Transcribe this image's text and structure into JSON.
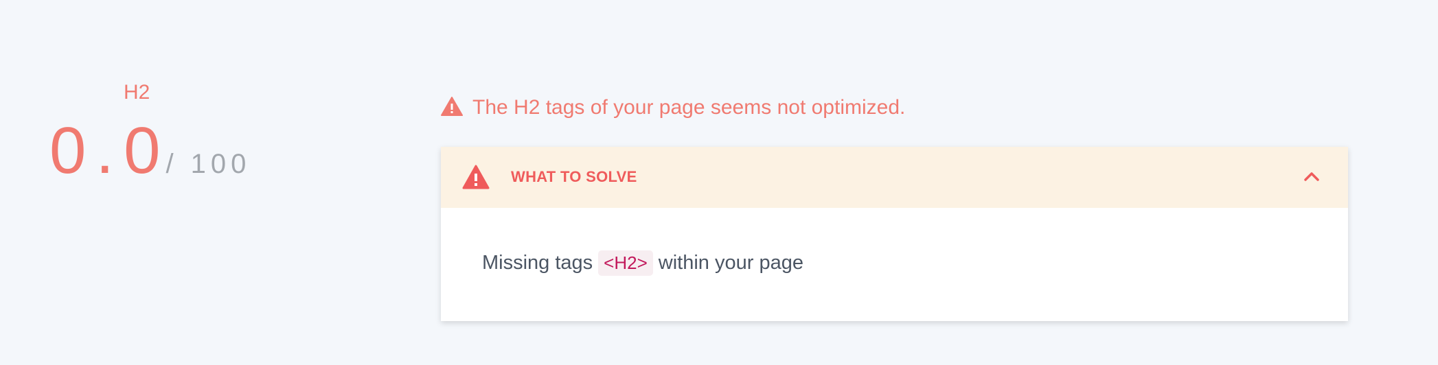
{
  "score": {
    "label": "H2",
    "value": "0.0",
    "max": "/ 100"
  },
  "warning": {
    "icon": "warning-triangle-icon",
    "text": "The H2 tags of your page seems not optimized."
  },
  "card": {
    "header_icon": "warning-triangle-icon",
    "title": "WHAT TO SOLVE",
    "toggle_icon": "chevron-up-icon",
    "issue": {
      "prefix": "Missing tags",
      "tag": "<H2>",
      "suffix": "within your page"
    }
  },
  "colors": {
    "background": "#f4f7fb",
    "accent": "#f07a70",
    "danger": "#ef5b5b",
    "header_bg": "#fcf2e3",
    "code_text": "#c2185b",
    "code_bg": "#f7eef1"
  }
}
